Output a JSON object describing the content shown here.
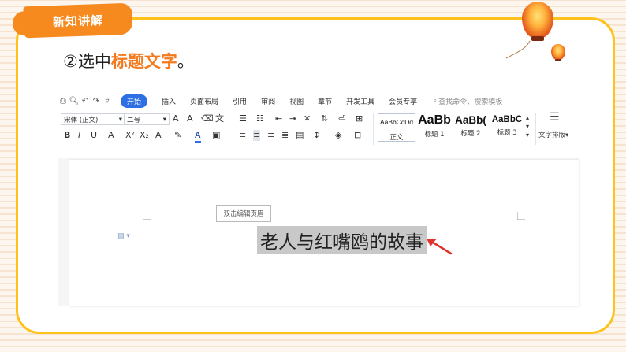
{
  "banner": {
    "title": "新知讲解"
  },
  "step": {
    "prefix": "②选中",
    "highlight": "标题文字",
    "suffix": "。"
  },
  "menubar": {
    "items": [
      "开始",
      "插入",
      "页面布局",
      "引用",
      "审阅",
      "视图",
      "章节",
      "开发工具",
      "会员专享"
    ],
    "active": "开始",
    "search_placeholder": "查找命令、搜索模板"
  },
  "toolbar": {
    "font_name": "宋体 (正文)",
    "font_size": "二号",
    "styles": [
      {
        "sample": "AaBbCcDd",
        "label": "正文"
      },
      {
        "sample": "AaBb",
        "label": "标题 1"
      },
      {
        "sample": "AaBb(",
        "label": "标题 2"
      },
      {
        "sample": "AaBbC",
        "label": "标题 3"
      }
    ],
    "text_layout_label": "文字排版"
  },
  "document": {
    "header_hint": "双击编辑页眉",
    "selected_title": "老人与红嘴鸥的故事"
  },
  "colors": {
    "accent": "#f47a1f",
    "frame": "#ffc21a",
    "wps_blue": "#2f6fe4",
    "arrow": "#e0322a"
  }
}
